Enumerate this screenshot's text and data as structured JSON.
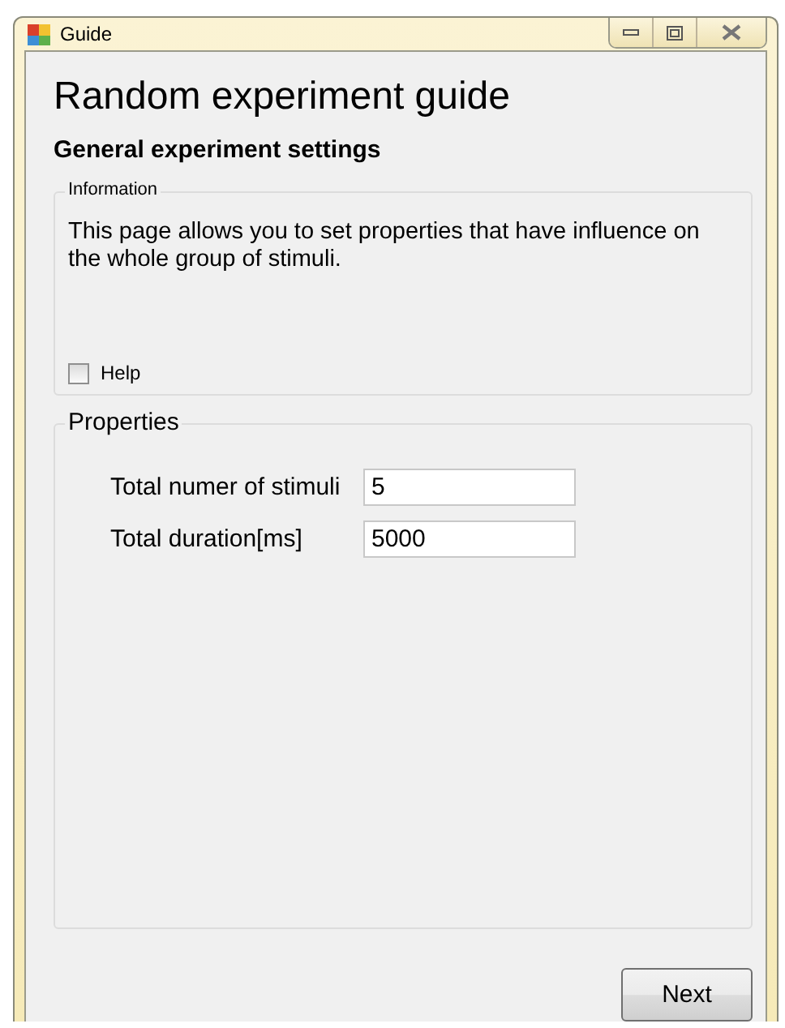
{
  "window": {
    "title": "Guide"
  },
  "heading": "Random experiment guide",
  "subheading": "General experiment settings",
  "information": {
    "legend": "Information",
    "text": "This page allows you to set properties that have influence on the whole group of stimuli.",
    "help": {
      "label": "Help",
      "checked": false
    }
  },
  "properties": {
    "legend": "Properties",
    "fields": [
      {
        "label": "Total numer of stimuli",
        "value": "5"
      },
      {
        "label": "Total duration[ms]",
        "value": "5000"
      }
    ]
  },
  "buttons": [
    "Next"
  ]
}
